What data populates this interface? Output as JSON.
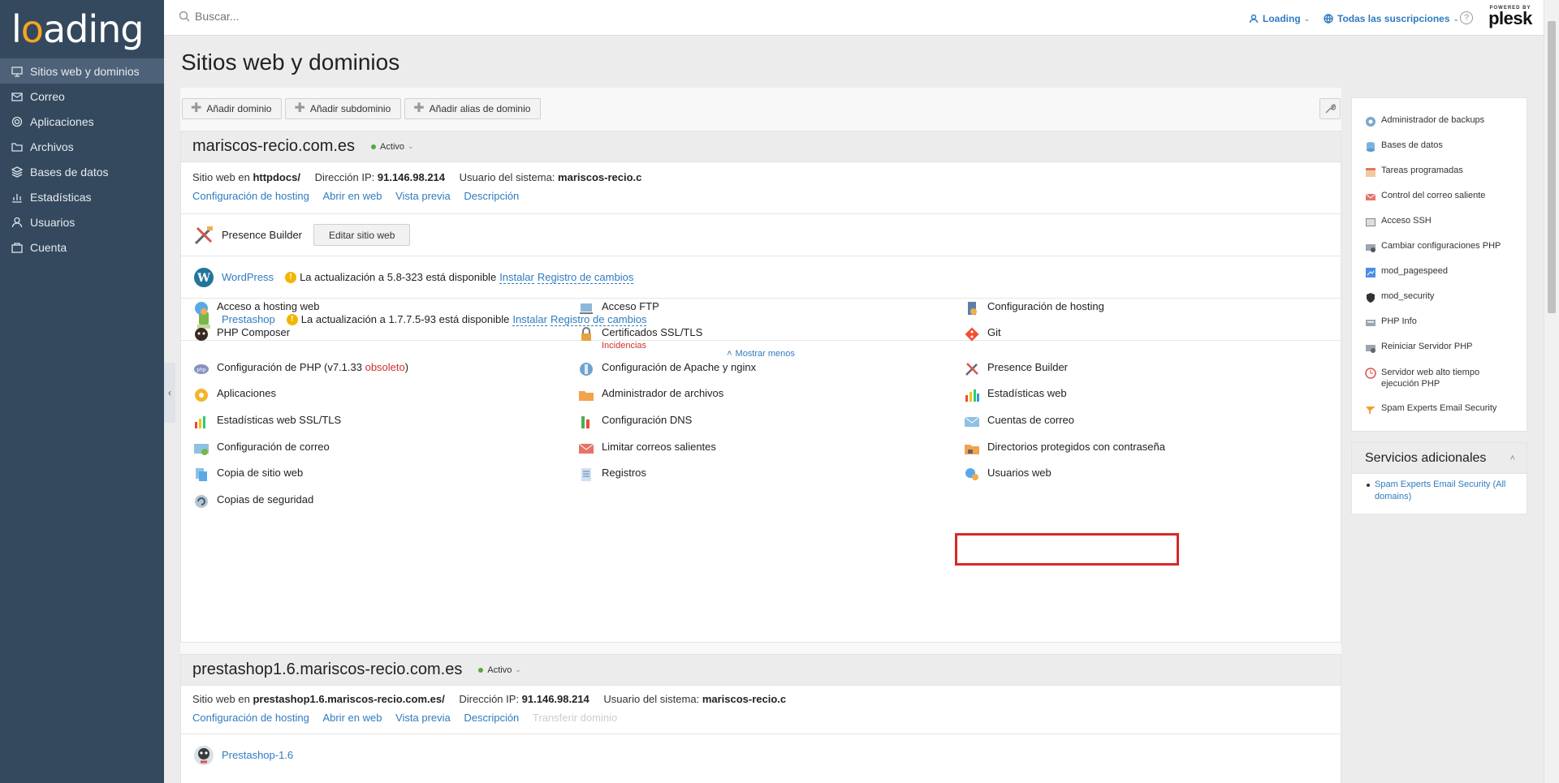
{
  "brand": {
    "logo_text_a": "l",
    "logo_text_o": "o",
    "logo_text_b": "ading"
  },
  "sidebar": {
    "items": [
      {
        "label": "Sitios web y dominios",
        "icon": "monitor-icon",
        "active": true
      },
      {
        "label": "Correo",
        "icon": "mail-icon"
      },
      {
        "label": "Aplicaciones",
        "icon": "gear-icon"
      },
      {
        "label": "Archivos",
        "icon": "folder-icon"
      },
      {
        "label": "Bases de datos",
        "icon": "database-icon"
      },
      {
        "label": "Estadísticas",
        "icon": "bar-chart-icon"
      },
      {
        "label": "Usuarios",
        "icon": "user-icon"
      },
      {
        "label": "Cuenta",
        "icon": "account-icon"
      }
    ]
  },
  "topbar": {
    "search_placeholder": "Buscar...",
    "user_menu": "Loading",
    "subscriptions": "Todas las suscripciones",
    "help": "?",
    "powered_by": "POWERED BY",
    "plesk": "plesk"
  },
  "page": {
    "title": "Sitios web y dominios"
  },
  "toolbar": {
    "add_domain": "Añadir dominio",
    "add_subdomain": "Añadir subdominio",
    "add_alias": "Añadir alias de dominio"
  },
  "domain1": {
    "name": "mariscos-recio.com.es",
    "status": "Activo",
    "site_prefix": "Sitio web en ",
    "site_dir": "httpdocs/",
    "ip_label": "Dirección IP: ",
    "ip": "91.146.98.214",
    "user_label": "Usuario del sistema: ",
    "user": "mariscos-recio.c",
    "links": [
      "Configuración de hosting",
      "Abrir en web",
      "Vista previa",
      "Descripción"
    ],
    "presence_builder": "Presence Builder",
    "edit_site": "Editar sitio web",
    "wordpress": "WordPress",
    "wp_update": "La actualización a 5.8-323 está disponible",
    "prestashop": "Prestashop",
    "ps_update": "La actualización a 1.7.7.5-93 está disponible",
    "install": "Instalar",
    "changelog": "Registro de cambios",
    "show_less": "Mostrar menos",
    "tools": {
      "hosting_access": "Acceso a hosting web",
      "ftp_access": "Acceso FTP",
      "hosting_config": "Configuración de hosting",
      "php_composer": "PHP Composer",
      "ssl": "Certificados SSL/TLS",
      "ssl_sub": "Incidencias",
      "git": "Git",
      "php_config_a": "Configuración de PHP (v7.1.33 ",
      "php_config_b": "obsoleto",
      "php_config_c": ")",
      "apache_nginx": "Configuración de Apache y nginx",
      "presence_builder": "Presence Builder",
      "apps": "Aplicaciones",
      "file_manager": "Administrador de archivos",
      "web_stats": "Estadísticas web",
      "web_stats_ssl": "Estadísticas web SSL/TLS",
      "dns": "Configuración DNS",
      "mail_accounts": "Cuentas de correo",
      "mail_config": "Configuración de correo",
      "limit_outgoing": "Limitar correos salientes",
      "protected_dirs": "Directorios protegidos con contraseña",
      "site_copy": "Copia de sitio web",
      "logs": "Registros",
      "web_users": "Usuarios web",
      "backups": "Copias de seguridad"
    }
  },
  "domain2": {
    "name": "prestashop1.6.mariscos-recio.com.es",
    "status": "Activo",
    "site_prefix": "Sitio web en ",
    "site_dir": "prestashop1.6.mariscos-recio.com.es/",
    "ip_label": "Dirección IP: ",
    "ip": "91.146.98.214",
    "user_label": "Usuario del sistema: ",
    "user": "mariscos-recio.c",
    "links": [
      "Configuración de hosting",
      "Abrir en web",
      "Vista previa",
      "Descripción"
    ],
    "transfer": "Transferir dominio",
    "app": "Prestashop-1.6"
  },
  "right_panel": {
    "items": [
      "Administrador de backups",
      "Bases de datos",
      "Tareas programadas",
      "Control del correo saliente",
      "Acceso SSH",
      "Cambiar configuraciones PHP",
      "mod_pagespeed",
      "mod_security",
      "PHP Info",
      "Reiniciar Servidor PHP",
      "Servidor web alto tiempo ejecución PHP",
      "Spam Experts Email Security"
    ]
  },
  "extras": {
    "title": "Servicios adicionales",
    "item": "Spam Experts Email Security (All domains)"
  }
}
